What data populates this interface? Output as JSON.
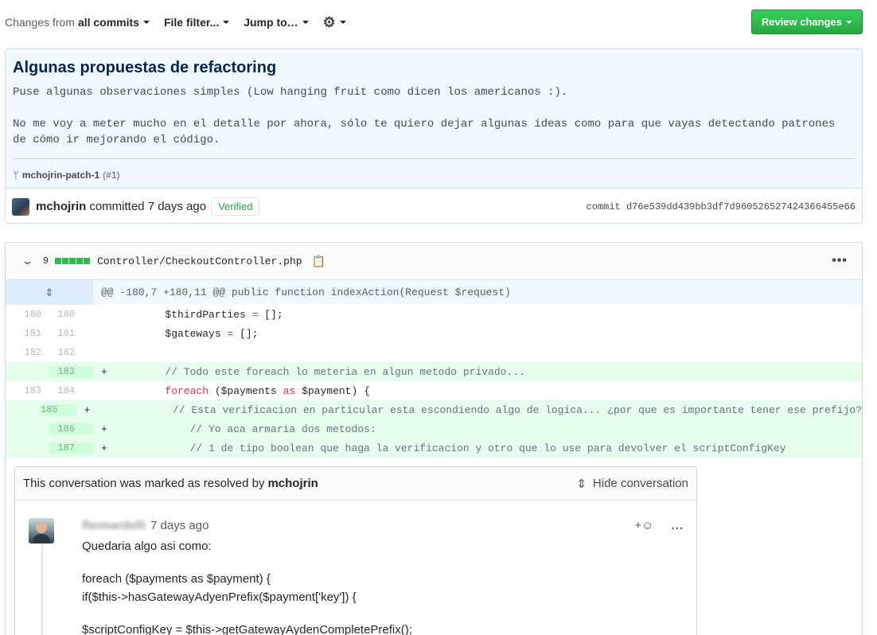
{
  "toolbar": {
    "changes_prefix": "Changes from",
    "changes_value": "all commits",
    "file_filter": "File filter...",
    "jump_to": "Jump to…",
    "settings_icon": "gear-icon",
    "review_button": "Review changes"
  },
  "commit": {
    "title": "Algunas propuestas de refactoring",
    "description_1": "Puse algunas observaciones simples (Low hanging fruit como dicen los americanos :).",
    "description_2": "No me voy a meter mucho en el detalle por ahora, sólo te quiero dejar algunas ideas como para que vayas detectando patrones de cómo ir mejorando el código.",
    "branch": "mchojrin-patch-1",
    "pr_ref": "(#1)",
    "author": "mchojrin",
    "committed_text": "committed 7 days ago",
    "verified_badge": "Verified",
    "sha_text": "commit d76e539dd439bb3df7d960526527424366455e66"
  },
  "file": {
    "changes_count": "9",
    "path": "Controller/CheckoutController.php",
    "hunk_header": "@@ -180,7 +180,11 @@ public function indexAction(Request $request)",
    "lines": [
      {
        "old": "180",
        "new": "180",
        "sign": "",
        "type": "ctx",
        "code": "        $thirdParties = [];"
      },
      {
        "old": "181",
        "new": "181",
        "sign": "",
        "type": "ctx",
        "code": "        $gateways = [];"
      },
      {
        "old": "182",
        "new": "182",
        "sign": "",
        "type": "ctx",
        "code": ""
      },
      {
        "old": "",
        "new": "183",
        "sign": "+",
        "type": "add",
        "code": "        // Todo este foreach lo meteria en algun metodo privado..."
      },
      {
        "old": "183",
        "new": "184",
        "sign": "",
        "type": "ctx",
        "code": "        foreach ($payments as $payment) {"
      },
      {
        "old": "",
        "new": "185",
        "sign": "+",
        "type": "add",
        "code": "            // Esta verificacion en particular esta escondiendo algo de logica... ¿por que es importante tener ese prefijo?"
      },
      {
        "old": "",
        "new": "186",
        "sign": "+",
        "type": "add",
        "code": "            // Yo aca armaria dos metodos:"
      },
      {
        "old": "",
        "new": "187",
        "sign": "+",
        "type": "add",
        "code": "            // 1 de tipo boolean que haga la verificacion y otro que lo use para devolver el scriptConfigKey"
      }
    ]
  },
  "conversation": {
    "resolved_prefix": "This conversation was marked as resolved by",
    "resolved_by": "mchojrin",
    "hide_label": "Hide conversation",
    "comment": {
      "author": "fleonardelli",
      "time": "7 days ago",
      "reaction_label": "+",
      "menu_label": "...",
      "body": [
        "Quedaria algo asi como:",
        "foreach ($payments as $payment) {",
        "if($this->hasGatewayAdyenPrefix($payment['key']) {",
        "$scriptConfigKey = $this->getGatewayAydenCompletePrefix();"
      ]
    }
  }
}
